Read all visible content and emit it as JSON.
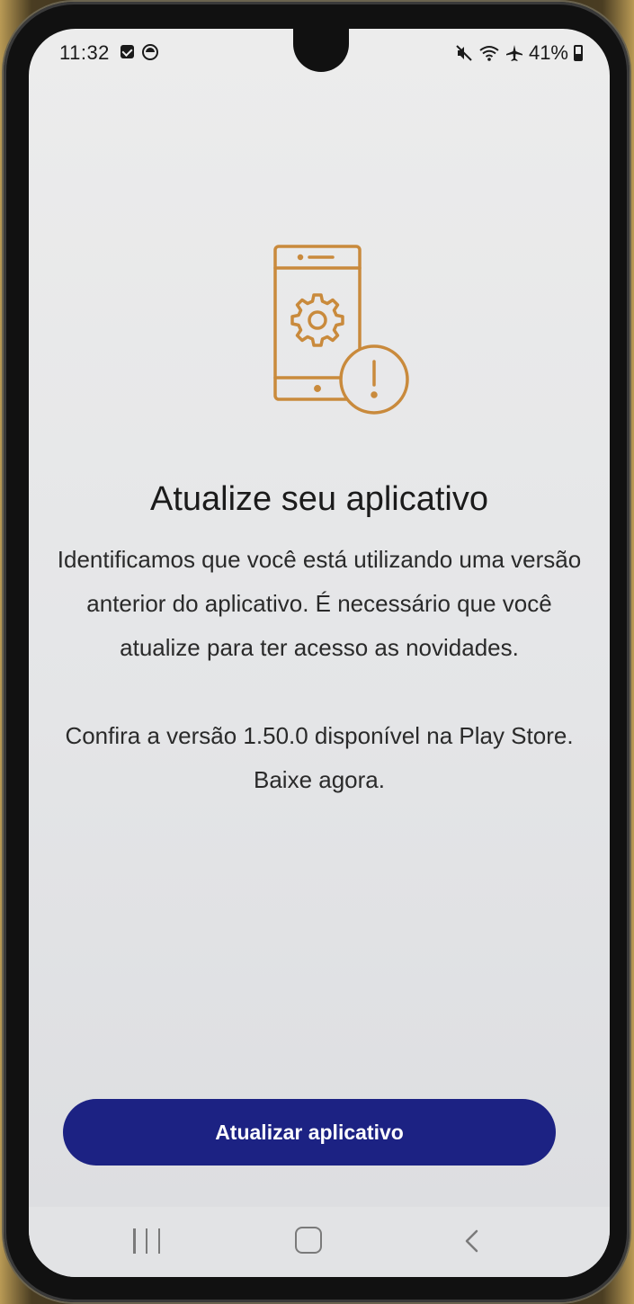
{
  "status_bar": {
    "time": "11:32",
    "battery_text": "41%",
    "icons": [
      "checkbox-notification-icon",
      "circle-notification-icon",
      "mute-icon",
      "wifi-icon",
      "airplane-mode-icon",
      "battery-icon"
    ]
  },
  "illustration": {
    "icon": "phone-settings-warning-icon",
    "color": "#c98a3c"
  },
  "content": {
    "title": "Atualize seu aplicativo",
    "message": "Identificamos que você está utilizando uma versão anterior do aplicativo. É necessário que você atualize para ter acesso as novidades.",
    "version_note": "Confira a versão 1.50.0 disponível na Play Store. Baixe agora."
  },
  "actions": {
    "update_label": "Atualizar aplicativo",
    "button_color": "#1c2283"
  },
  "nav_bar": {
    "buttons": [
      "recents-icon",
      "home-icon",
      "back-icon"
    ]
  }
}
